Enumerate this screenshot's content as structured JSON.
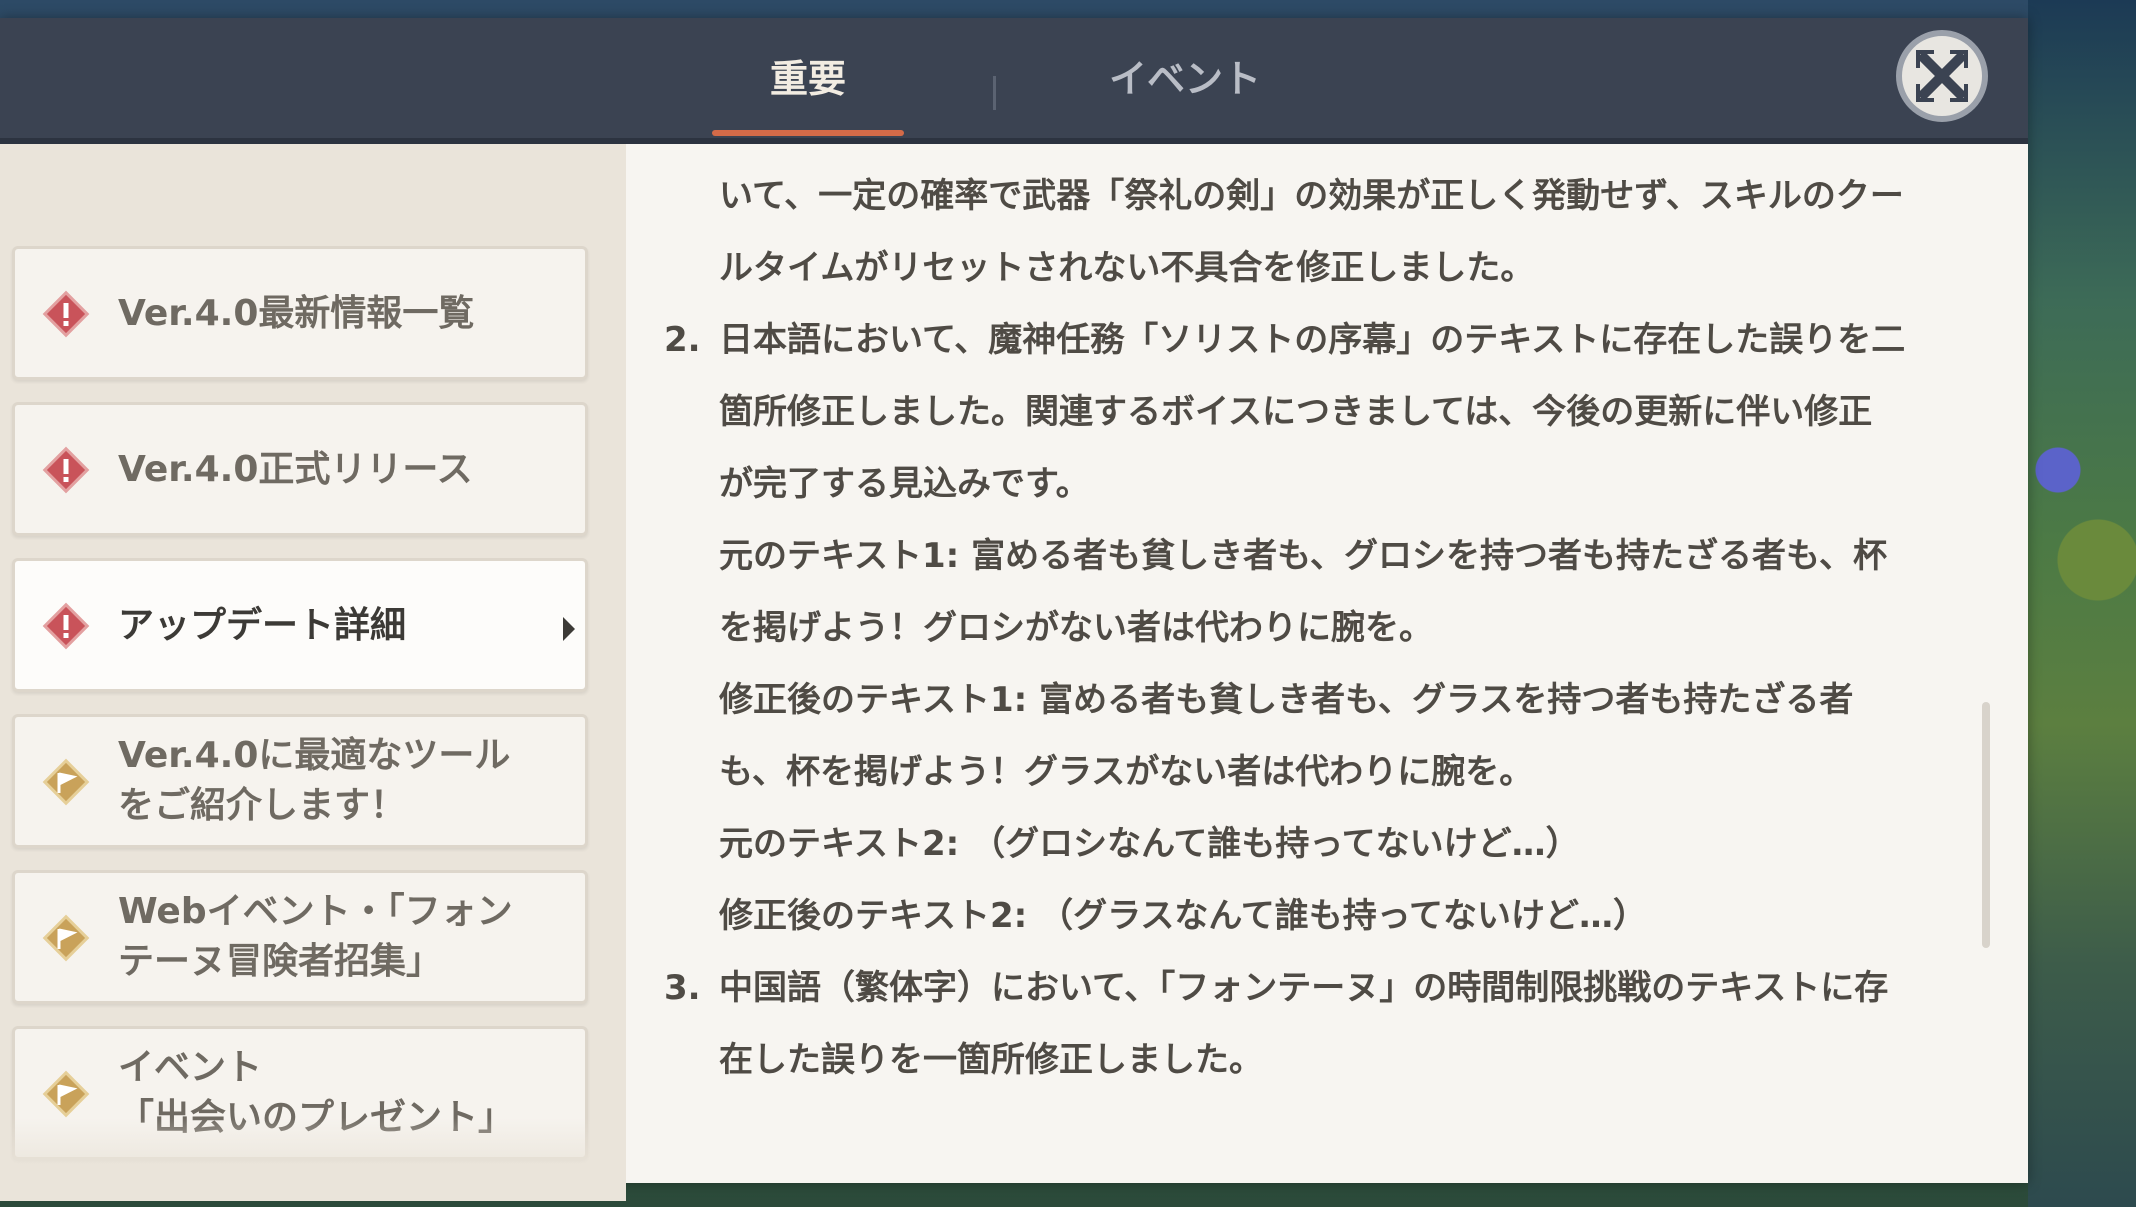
{
  "tabs": [
    {
      "label": "重要"
    },
    {
      "label": "イベント"
    }
  ],
  "sidebar": {
    "items": [
      {
        "line1": "Ver.4.0最新情報一覧",
        "line2": "",
        "icon": "important-icon"
      },
      {
        "line1": "Ver.4.0正式リリース",
        "line2": "",
        "icon": "important-icon"
      },
      {
        "line1": "アップデート詳細",
        "line2": "",
        "icon": "important-icon"
      },
      {
        "line1": "Ver.4.0に最適なツール",
        "line2": "をご紹介します！",
        "icon": "event-flag-icon"
      },
      {
        "line1": "Webイベント・「フォン",
        "line2": "テーヌ冒険者招集」",
        "icon": "event-flag-icon"
      },
      {
        "line1": "イベント",
        "line2": "「出会いのプレゼント」",
        "icon": "event-flag-icon"
      }
    ]
  },
  "content": {
    "lines": [
      "いて、一定の確率で武器「祭礼の剣」の効果が正しく発動せず、スキルのクー",
      "ルタイムがリセットされない不具合を修正しました。",
      "日本語において、魔神任務「ソリストの序幕」のテキストに存在した誤りを二",
      "箇所修正しました。関連するボイスにつきましては、今後の更新に伴い修正",
      "が完了する見込みです。",
      "元のテキスト1: 富める者も貧しき者も、グロシを持つ者も持たざる者も、杯",
      "を掲げよう！グロシがない者は代わりに腕を。",
      "修正後のテキスト1: 富める者も貧しき者も、グラスを持つ者も持たざる者",
      "も、杯を掲げよう！グラスがない者は代わりに腕を。",
      "元のテキスト2: （グロシなんて誰も持ってないけど…）",
      "修正後のテキスト2: （グラスなんて誰も持ってないけど…）",
      "中国語（繁体字）において、「フォンテーヌ」の時間制限挑戦のテキストに存",
      "在した誤りを一箇所修正しました。"
    ],
    "numbers": [
      "2.",
      "3."
    ]
  },
  "colors": {
    "header": "#3b4352",
    "tab_underline": "#d36a48",
    "important_icon": "#c9535a",
    "event_icon": "#c9a25a"
  }
}
